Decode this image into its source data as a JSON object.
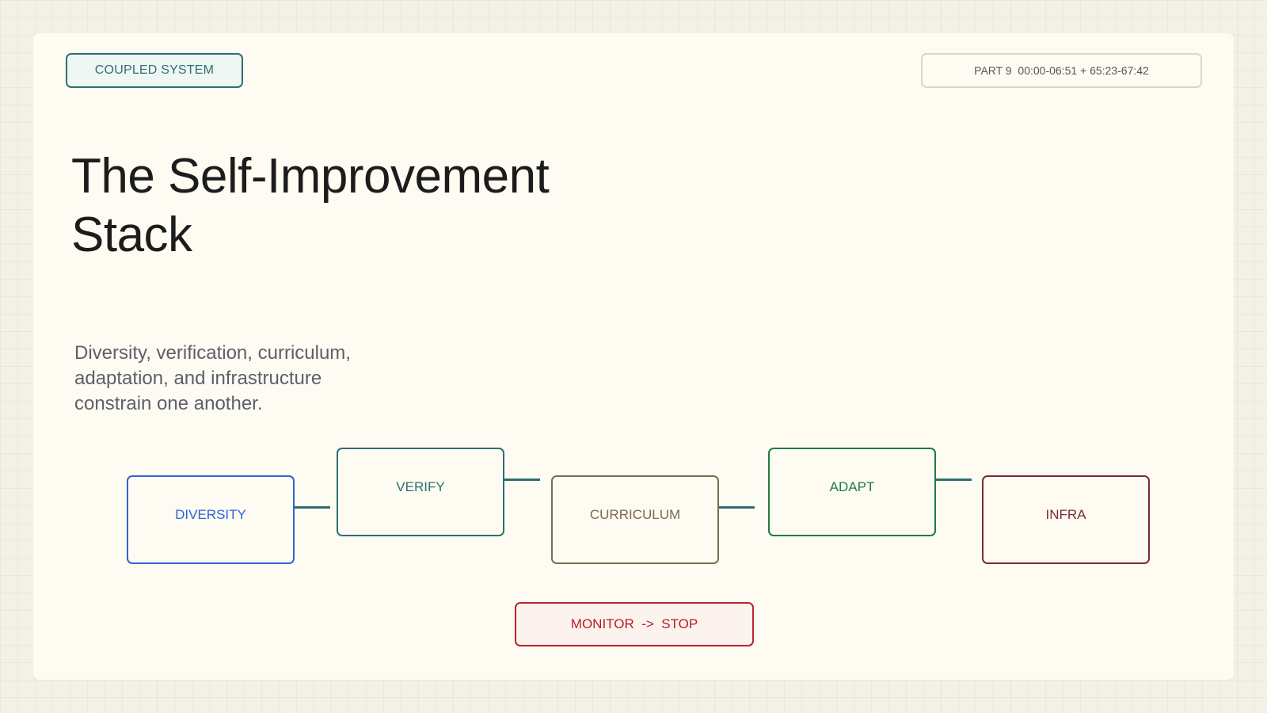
{
  "header": {
    "section_tag": "COUPLED SYSTEM",
    "part_tag": "PART 9  00:00-06:51 + 65:23-67:42"
  },
  "main": {
    "title": "The Self-Improvement Stack",
    "subtitle": "Diversity, verification, curriculum, adaptation, and infrastructure constrain one another."
  },
  "diagram": {
    "nodes": [
      {
        "label": "DIVERSITY",
        "color": "#2f63d6"
      },
      {
        "label": "VERIFY",
        "color": "#2f6f73"
      },
      {
        "label": "CURRICULUM",
        "color": "#7d6a4f"
      },
      {
        "label": "ADAPT",
        "color": "#1d7d3e"
      },
      {
        "label": "INFRA",
        "color": "#7a2a36"
      }
    ],
    "connector_color": "#2f6f73",
    "monitor_label": "MONITOR  ->  STOP",
    "monitor_color": "#b7262b"
  }
}
